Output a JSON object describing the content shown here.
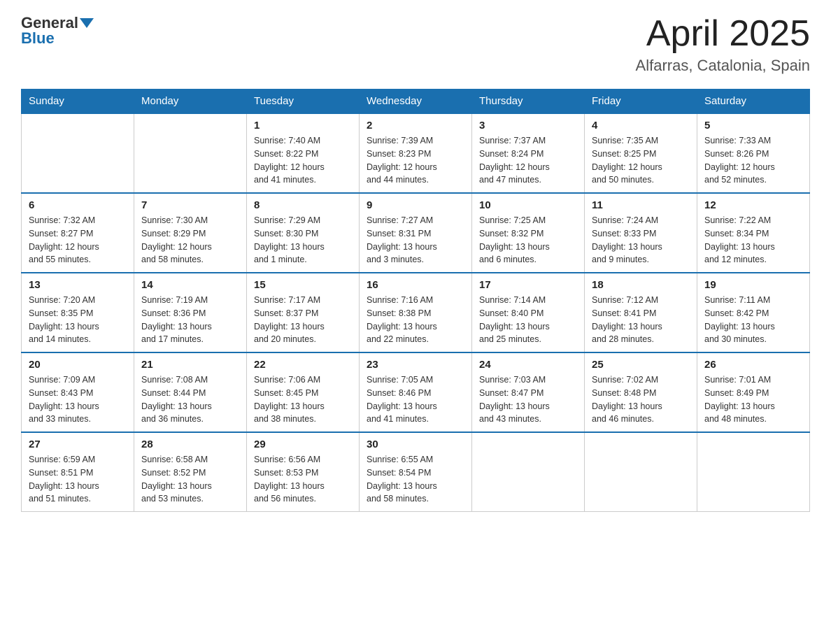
{
  "header": {
    "logo": {
      "general": "General",
      "blue": "Blue"
    },
    "title": "April 2025",
    "location": "Alfarras, Catalonia, Spain"
  },
  "weekdays": [
    "Sunday",
    "Monday",
    "Tuesday",
    "Wednesday",
    "Thursday",
    "Friday",
    "Saturday"
  ],
  "weeks": [
    [
      {
        "day": "",
        "info": ""
      },
      {
        "day": "",
        "info": ""
      },
      {
        "day": "1",
        "info": "Sunrise: 7:40 AM\nSunset: 8:22 PM\nDaylight: 12 hours\nand 41 minutes."
      },
      {
        "day": "2",
        "info": "Sunrise: 7:39 AM\nSunset: 8:23 PM\nDaylight: 12 hours\nand 44 minutes."
      },
      {
        "day": "3",
        "info": "Sunrise: 7:37 AM\nSunset: 8:24 PM\nDaylight: 12 hours\nand 47 minutes."
      },
      {
        "day": "4",
        "info": "Sunrise: 7:35 AM\nSunset: 8:25 PM\nDaylight: 12 hours\nand 50 minutes."
      },
      {
        "day": "5",
        "info": "Sunrise: 7:33 AM\nSunset: 8:26 PM\nDaylight: 12 hours\nand 52 minutes."
      }
    ],
    [
      {
        "day": "6",
        "info": "Sunrise: 7:32 AM\nSunset: 8:27 PM\nDaylight: 12 hours\nand 55 minutes."
      },
      {
        "day": "7",
        "info": "Sunrise: 7:30 AM\nSunset: 8:29 PM\nDaylight: 12 hours\nand 58 minutes."
      },
      {
        "day": "8",
        "info": "Sunrise: 7:29 AM\nSunset: 8:30 PM\nDaylight: 13 hours\nand 1 minute."
      },
      {
        "day": "9",
        "info": "Sunrise: 7:27 AM\nSunset: 8:31 PM\nDaylight: 13 hours\nand 3 minutes."
      },
      {
        "day": "10",
        "info": "Sunrise: 7:25 AM\nSunset: 8:32 PM\nDaylight: 13 hours\nand 6 minutes."
      },
      {
        "day": "11",
        "info": "Sunrise: 7:24 AM\nSunset: 8:33 PM\nDaylight: 13 hours\nand 9 minutes."
      },
      {
        "day": "12",
        "info": "Sunrise: 7:22 AM\nSunset: 8:34 PM\nDaylight: 13 hours\nand 12 minutes."
      }
    ],
    [
      {
        "day": "13",
        "info": "Sunrise: 7:20 AM\nSunset: 8:35 PM\nDaylight: 13 hours\nand 14 minutes."
      },
      {
        "day": "14",
        "info": "Sunrise: 7:19 AM\nSunset: 8:36 PM\nDaylight: 13 hours\nand 17 minutes."
      },
      {
        "day": "15",
        "info": "Sunrise: 7:17 AM\nSunset: 8:37 PM\nDaylight: 13 hours\nand 20 minutes."
      },
      {
        "day": "16",
        "info": "Sunrise: 7:16 AM\nSunset: 8:38 PM\nDaylight: 13 hours\nand 22 minutes."
      },
      {
        "day": "17",
        "info": "Sunrise: 7:14 AM\nSunset: 8:40 PM\nDaylight: 13 hours\nand 25 minutes."
      },
      {
        "day": "18",
        "info": "Sunrise: 7:12 AM\nSunset: 8:41 PM\nDaylight: 13 hours\nand 28 minutes."
      },
      {
        "day": "19",
        "info": "Sunrise: 7:11 AM\nSunset: 8:42 PM\nDaylight: 13 hours\nand 30 minutes."
      }
    ],
    [
      {
        "day": "20",
        "info": "Sunrise: 7:09 AM\nSunset: 8:43 PM\nDaylight: 13 hours\nand 33 minutes."
      },
      {
        "day": "21",
        "info": "Sunrise: 7:08 AM\nSunset: 8:44 PM\nDaylight: 13 hours\nand 36 minutes."
      },
      {
        "day": "22",
        "info": "Sunrise: 7:06 AM\nSunset: 8:45 PM\nDaylight: 13 hours\nand 38 minutes."
      },
      {
        "day": "23",
        "info": "Sunrise: 7:05 AM\nSunset: 8:46 PM\nDaylight: 13 hours\nand 41 minutes."
      },
      {
        "day": "24",
        "info": "Sunrise: 7:03 AM\nSunset: 8:47 PM\nDaylight: 13 hours\nand 43 minutes."
      },
      {
        "day": "25",
        "info": "Sunrise: 7:02 AM\nSunset: 8:48 PM\nDaylight: 13 hours\nand 46 minutes."
      },
      {
        "day": "26",
        "info": "Sunrise: 7:01 AM\nSunset: 8:49 PM\nDaylight: 13 hours\nand 48 minutes."
      }
    ],
    [
      {
        "day": "27",
        "info": "Sunrise: 6:59 AM\nSunset: 8:51 PM\nDaylight: 13 hours\nand 51 minutes."
      },
      {
        "day": "28",
        "info": "Sunrise: 6:58 AM\nSunset: 8:52 PM\nDaylight: 13 hours\nand 53 minutes."
      },
      {
        "day": "29",
        "info": "Sunrise: 6:56 AM\nSunset: 8:53 PM\nDaylight: 13 hours\nand 56 minutes."
      },
      {
        "day": "30",
        "info": "Sunrise: 6:55 AM\nSunset: 8:54 PM\nDaylight: 13 hours\nand 58 minutes."
      },
      {
        "day": "",
        "info": ""
      },
      {
        "day": "",
        "info": ""
      },
      {
        "day": "",
        "info": ""
      }
    ]
  ]
}
